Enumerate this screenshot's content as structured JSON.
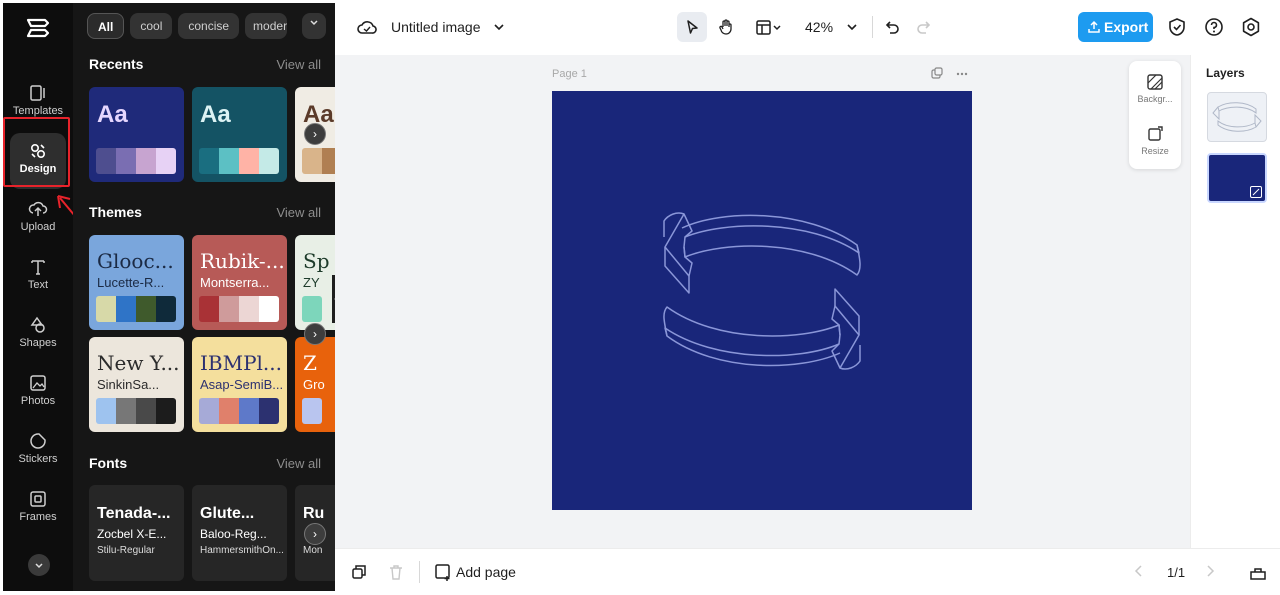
{
  "app": {
    "file_title": "Untitled image",
    "zoom": "42%",
    "export_label": "Export"
  },
  "rail": {
    "items": [
      {
        "label": "Templates",
        "icon": "templates-icon"
      },
      {
        "label": "Design",
        "icon": "design-icon",
        "active": true
      },
      {
        "label": "Upload",
        "icon": "upload-icon"
      },
      {
        "label": "Text",
        "icon": "text-icon"
      },
      {
        "label": "Shapes",
        "icon": "shapes-icon"
      },
      {
        "label": "Photos",
        "icon": "photos-icon"
      },
      {
        "label": "Stickers",
        "icon": "stickers-icon"
      },
      {
        "label": "Frames",
        "icon": "frames-icon"
      }
    ]
  },
  "panel": {
    "chips": [
      "All",
      "cool",
      "concise",
      "modern"
    ],
    "recents": {
      "title": "Recents",
      "view_all": "View all",
      "cards": [
        {
          "aa": "Aa",
          "bg": "#1f2a7a",
          "aa_color": "#e6d7ff",
          "colors": [
            "#4e4e8f",
            "#7a6eb2",
            "#c7a4d0",
            "#e7d2f5"
          ]
        },
        {
          "aa": "Aa",
          "bg": "#145364",
          "aa_color": "#dcf3f4",
          "colors": [
            "#1a6e80",
            "#5cc0c4",
            "#ffb3a6",
            "#c4eae7"
          ]
        },
        {
          "aa": "Aa",
          "bg": "#f0ece4",
          "aa_color": "#5b3a29",
          "colors": [
            "#d9b48a",
            "#b07f52"
          ]
        }
      ]
    },
    "themes": {
      "title": "Themes",
      "view_all": "View all",
      "cards": [
        {
          "line1": "Glooc...",
          "line2": "Lucette-R...",
          "bg": "#7aa6dc",
          "fg": "#1b2a44",
          "colors": [
            "#d7d9a8",
            "#2f74c7",
            "#3f5a2c",
            "#0f2a3a"
          ]
        },
        {
          "line1": "Rubik-...",
          "line2": "Montserra...",
          "bg": "#b75a57",
          "fg": "#ffffff",
          "colors": [
            "#a93236",
            "#cf9b9b",
            "#ecd6d4",
            "#ffffff"
          ]
        },
        {
          "line1": "Sp",
          "line2": "ZY",
          "bg": "#e8efe6",
          "fg": "#1d3b2a",
          "colors": [
            "#7dd6bb"
          ]
        },
        {
          "line1": "New Y...",
          "line2": "SinkinSa...",
          "bg": "#ece6dc",
          "fg": "#2b2b2b",
          "colors": [
            "#9ec3ef",
            "#777777",
            "#494949",
            "#1c1c1c"
          ]
        },
        {
          "line1": "IBMPl...",
          "line2": "Asap-SemiB...",
          "bg": "#f4df9d",
          "fg": "#2c3170",
          "colors": [
            "#a6aad7",
            "#e0806b",
            "#5e79c9",
            "#2c3170"
          ]
        },
        {
          "line1": "Z",
          "line2": "Gro",
          "bg": "#e8620c",
          "fg": "#ffffff",
          "colors": [
            "#b9c5ef"
          ]
        }
      ]
    },
    "fonts": {
      "title": "Fonts",
      "view_all": "View all",
      "cards": [
        {
          "line1": "Tenada-...",
          "line2": "Zocbel X-E...",
          "line3": "Stilu-Regular"
        },
        {
          "line1": "Glute...",
          "line2": "Baloo-Reg...",
          "line3": "HammersmithOn..."
        },
        {
          "line1": "Ru",
          "line2": "",
          "line3": "Mon"
        }
      ]
    }
  },
  "canvas": {
    "page_label": "Page 1",
    "artboard_color": "#19267a",
    "side_tools": [
      "Backgr...",
      "Resize"
    ]
  },
  "layers": {
    "title": "Layers"
  },
  "bottom": {
    "add_page": "Add page",
    "pager": "1/1"
  }
}
